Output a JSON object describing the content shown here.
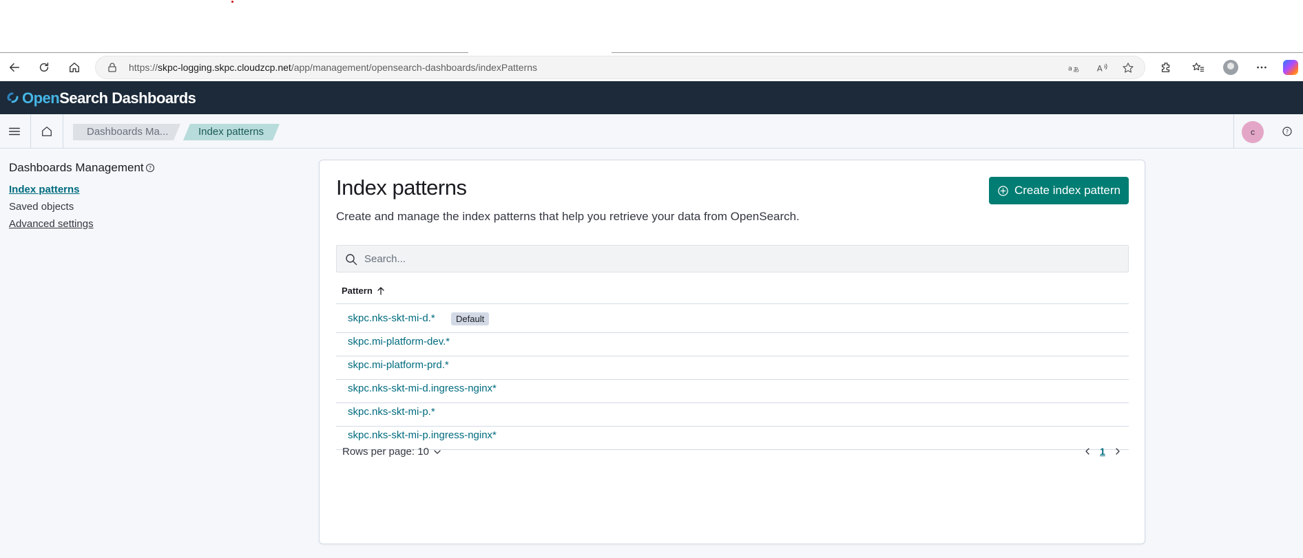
{
  "browser": {
    "url_prefix": "https://",
    "url_host": "skpc-logging.skpc.cloudzcp.net",
    "url_path": "/app/management/opensearch-dashboards/indexPatterns",
    "icons": [
      "back-icon",
      "refresh-icon",
      "home-icon",
      "lock-icon",
      "translate-icon",
      "read-aloud-icon",
      "favorite-star-icon",
      "extensions-icon",
      "favorites-icon",
      "profile-icon",
      "more-icon",
      "copilot-icon"
    ]
  },
  "app": {
    "brand_open": "Open",
    "brand_rest": "Search Dashboards"
  },
  "nav": {
    "breadcrumbs": [
      "Dashboards Ma...",
      "Index patterns"
    ],
    "user_initial": "c"
  },
  "sidebar": {
    "title": "Dashboards Management",
    "items": [
      {
        "label": "Index patterns",
        "active": true
      },
      {
        "label": "Saved objects",
        "active": false
      },
      {
        "label": "Advanced settings",
        "active": false
      }
    ]
  },
  "main": {
    "title": "Index patterns",
    "description": "Create and manage the index patterns that help you retrieve your data from OpenSearch.",
    "create_button": "Create index pattern",
    "search_placeholder": "Search...",
    "column_header": "Pattern",
    "rows": [
      {
        "pattern": "skpc.nks-skt-mi-d.*",
        "badge": "Default"
      },
      {
        "pattern": "skpc.mi-platform-dev.*"
      },
      {
        "pattern": "skpc.mi-platform-prd.*"
      },
      {
        "pattern": "skpc.nks-skt-mi-d.ingress-nginx*"
      },
      {
        "pattern": "skpc.nks-skt-mi-p.*"
      },
      {
        "pattern": "skpc.nks-skt-mi-p.ingress-nginx*"
      }
    ],
    "rows_per_page": "Rows per page: 10",
    "current_page": "1"
  },
  "colors": {
    "header_bg": "#1c2a3a",
    "accent": "#017d73",
    "link": "#006b7e"
  }
}
